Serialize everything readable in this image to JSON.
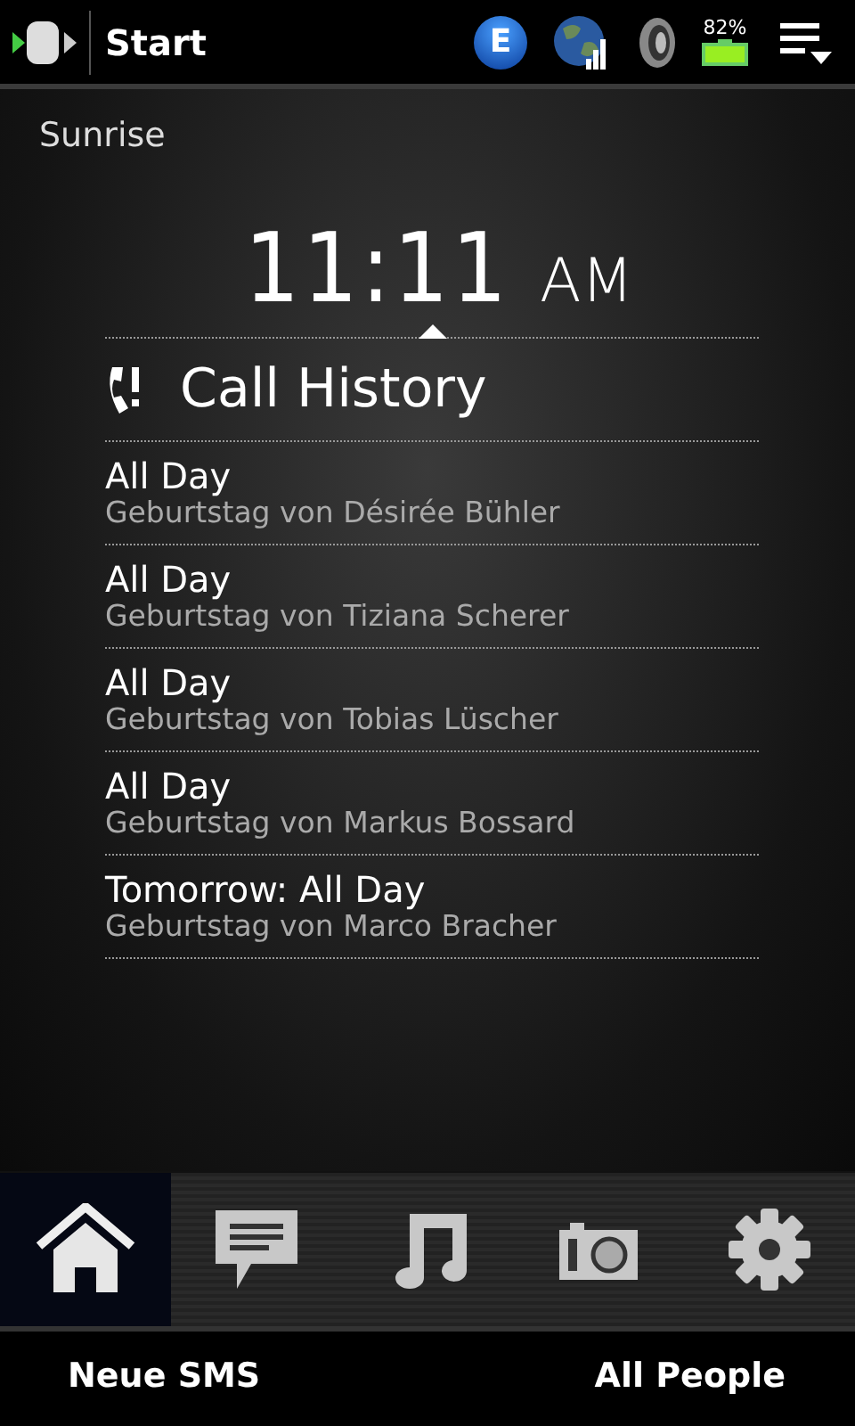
{
  "status_bar": {
    "title": "Start",
    "network": "E",
    "battery": "82%"
  },
  "clock": {
    "location": "Sunrise",
    "time": "11:11",
    "period": "AM"
  },
  "section": {
    "title": "Call History"
  },
  "events": [
    {
      "title": "All Day",
      "subtitle": "Geburtstag von Désirée Bühler"
    },
    {
      "title": "All Day",
      "subtitle": "Geburtstag von Tiziana Scherer"
    },
    {
      "title": "All Day",
      "subtitle": "Geburtstag von Tobias Lüscher"
    },
    {
      "title": "All Day",
      "subtitle": "Geburtstag von Markus Bossard"
    },
    {
      "title": "Tomorrow: All Day",
      "subtitle": "Geburtstag von Marco Bracher"
    }
  ],
  "tabs": [
    {
      "kind": "home",
      "selected": true
    },
    {
      "kind": "messages",
      "selected": false
    },
    {
      "kind": "music",
      "selected": false
    },
    {
      "kind": "camera",
      "selected": false
    },
    {
      "kind": "settings",
      "selected": false
    }
  ],
  "softkeys": [
    "Neue SMS",
    "All People"
  ]
}
